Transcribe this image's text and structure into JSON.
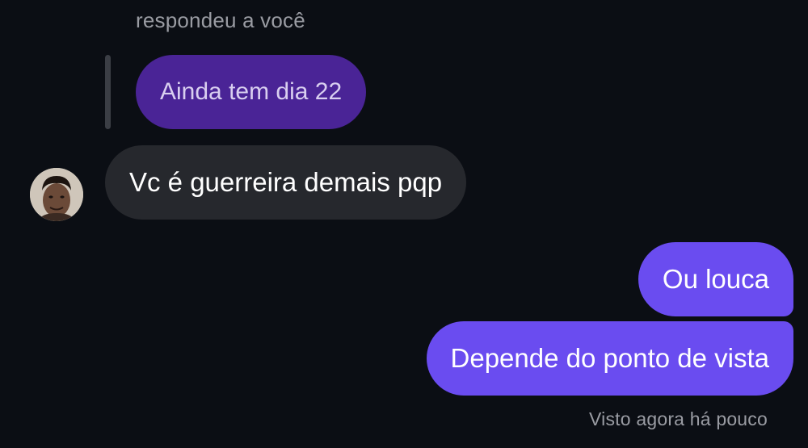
{
  "thread": {
    "reply_caption": "respondeu a você",
    "quoted_message": "Ainda tem dia 22",
    "received_message": "Vc é guerreira demais pqp",
    "sent_messages": [
      "Ou louca",
      "Depende do ponto de vista"
    ],
    "seen_status": "Visto agora há pouco"
  },
  "colors": {
    "background": "#0b0e14",
    "quoted_bubble": "#4a2496",
    "received_bubble": "#26282d",
    "sent_bubble": "#6a4cf0",
    "muted_text": "#9a9ca3"
  },
  "icons": {
    "avatar": "contact-avatar"
  }
}
